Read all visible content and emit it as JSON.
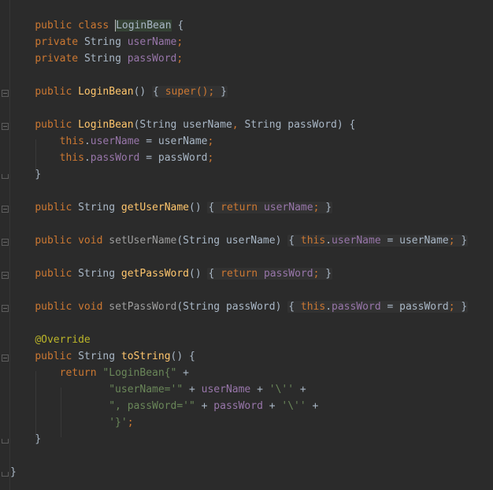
{
  "editor": {
    "lines": {
      "l1": {
        "kw1": "public",
        "kw2": "class",
        "name": "LoginBean",
        "brace": " {"
      },
      "l3": {
        "kw": "private",
        "type": "String",
        "field": "userName",
        "semi": ";"
      },
      "l4": {
        "kw": "private",
        "type": "String",
        "field": "passWord",
        "semi": ";"
      },
      "l6": {
        "kw": "public",
        "name": "LoginBean",
        "parens": "()",
        "folded": "{ super(); }",
        "fold_open": "{",
        "fold_super": "super",
        "fold_rest": "();",
        "fold_close": "}"
      },
      "l8": {
        "kw": "public",
        "name": "LoginBean",
        "params": "(String userName, String passWord) {",
        "p1": "(String userName",
        "comma": ",",
        "p2": " String passWord) {"
      },
      "l9": {
        "this": "this",
        "dot": ".",
        "field": "userName",
        "rest": " = userName",
        "semi": ";"
      },
      "l10": {
        "this": "this",
        "dot": ".",
        "field": "passWord",
        "rest": " = passWord",
        "semi": ";"
      },
      "l11": {
        "brace": "}"
      },
      "l13": {
        "kw": "public",
        "type": "String",
        "name": "getUserName",
        "parens": "()",
        "open": "{",
        "ret": "return",
        "field": "userName",
        "semi": ";",
        "close": "}"
      },
      "l15": {
        "kw1": "public",
        "kw2": "void",
        "name": "setUserName",
        "params": "(String userName)",
        "open": "{",
        "this": "this",
        "field": "userName",
        "rest": " = userName",
        "semi": ";",
        "close": "}"
      },
      "l17": {
        "kw": "public",
        "type": "String",
        "name": "getPassWord",
        "parens": "()",
        "open": "{",
        "ret": "return",
        "field": "passWord",
        "semi": ";",
        "close": "}"
      },
      "l19": {
        "kw1": "public",
        "kw2": "void",
        "name": "setPassWord",
        "params": "(String passWord)",
        "open": "{",
        "this": "this",
        "field": "passWord",
        "rest": " = passWord",
        "semi": ";",
        "close": "}"
      },
      "l21": {
        "ann": "@Override"
      },
      "l22": {
        "kw": "public",
        "type": "String",
        "name": "toString",
        "rest": "() {"
      },
      "l23": {
        "ret": "return",
        "str": "\"LoginBean{\"",
        "plus": " +"
      },
      "l24": {
        "str1": "\"userName='\"",
        "op1": " + ",
        "field": "userName",
        "op2": " + ",
        "str2": "'\\''",
        "plus": " +"
      },
      "l25": {
        "str1": "\", passWord='\"",
        "op1": " + ",
        "field": "passWord",
        "op2": " + ",
        "str2": "'\\''",
        "plus": " +"
      },
      "l26": {
        "str": "'}'",
        "semi": ";"
      },
      "l27": {
        "brace": "}"
      },
      "l29": {
        "brace": "}"
      }
    }
  }
}
